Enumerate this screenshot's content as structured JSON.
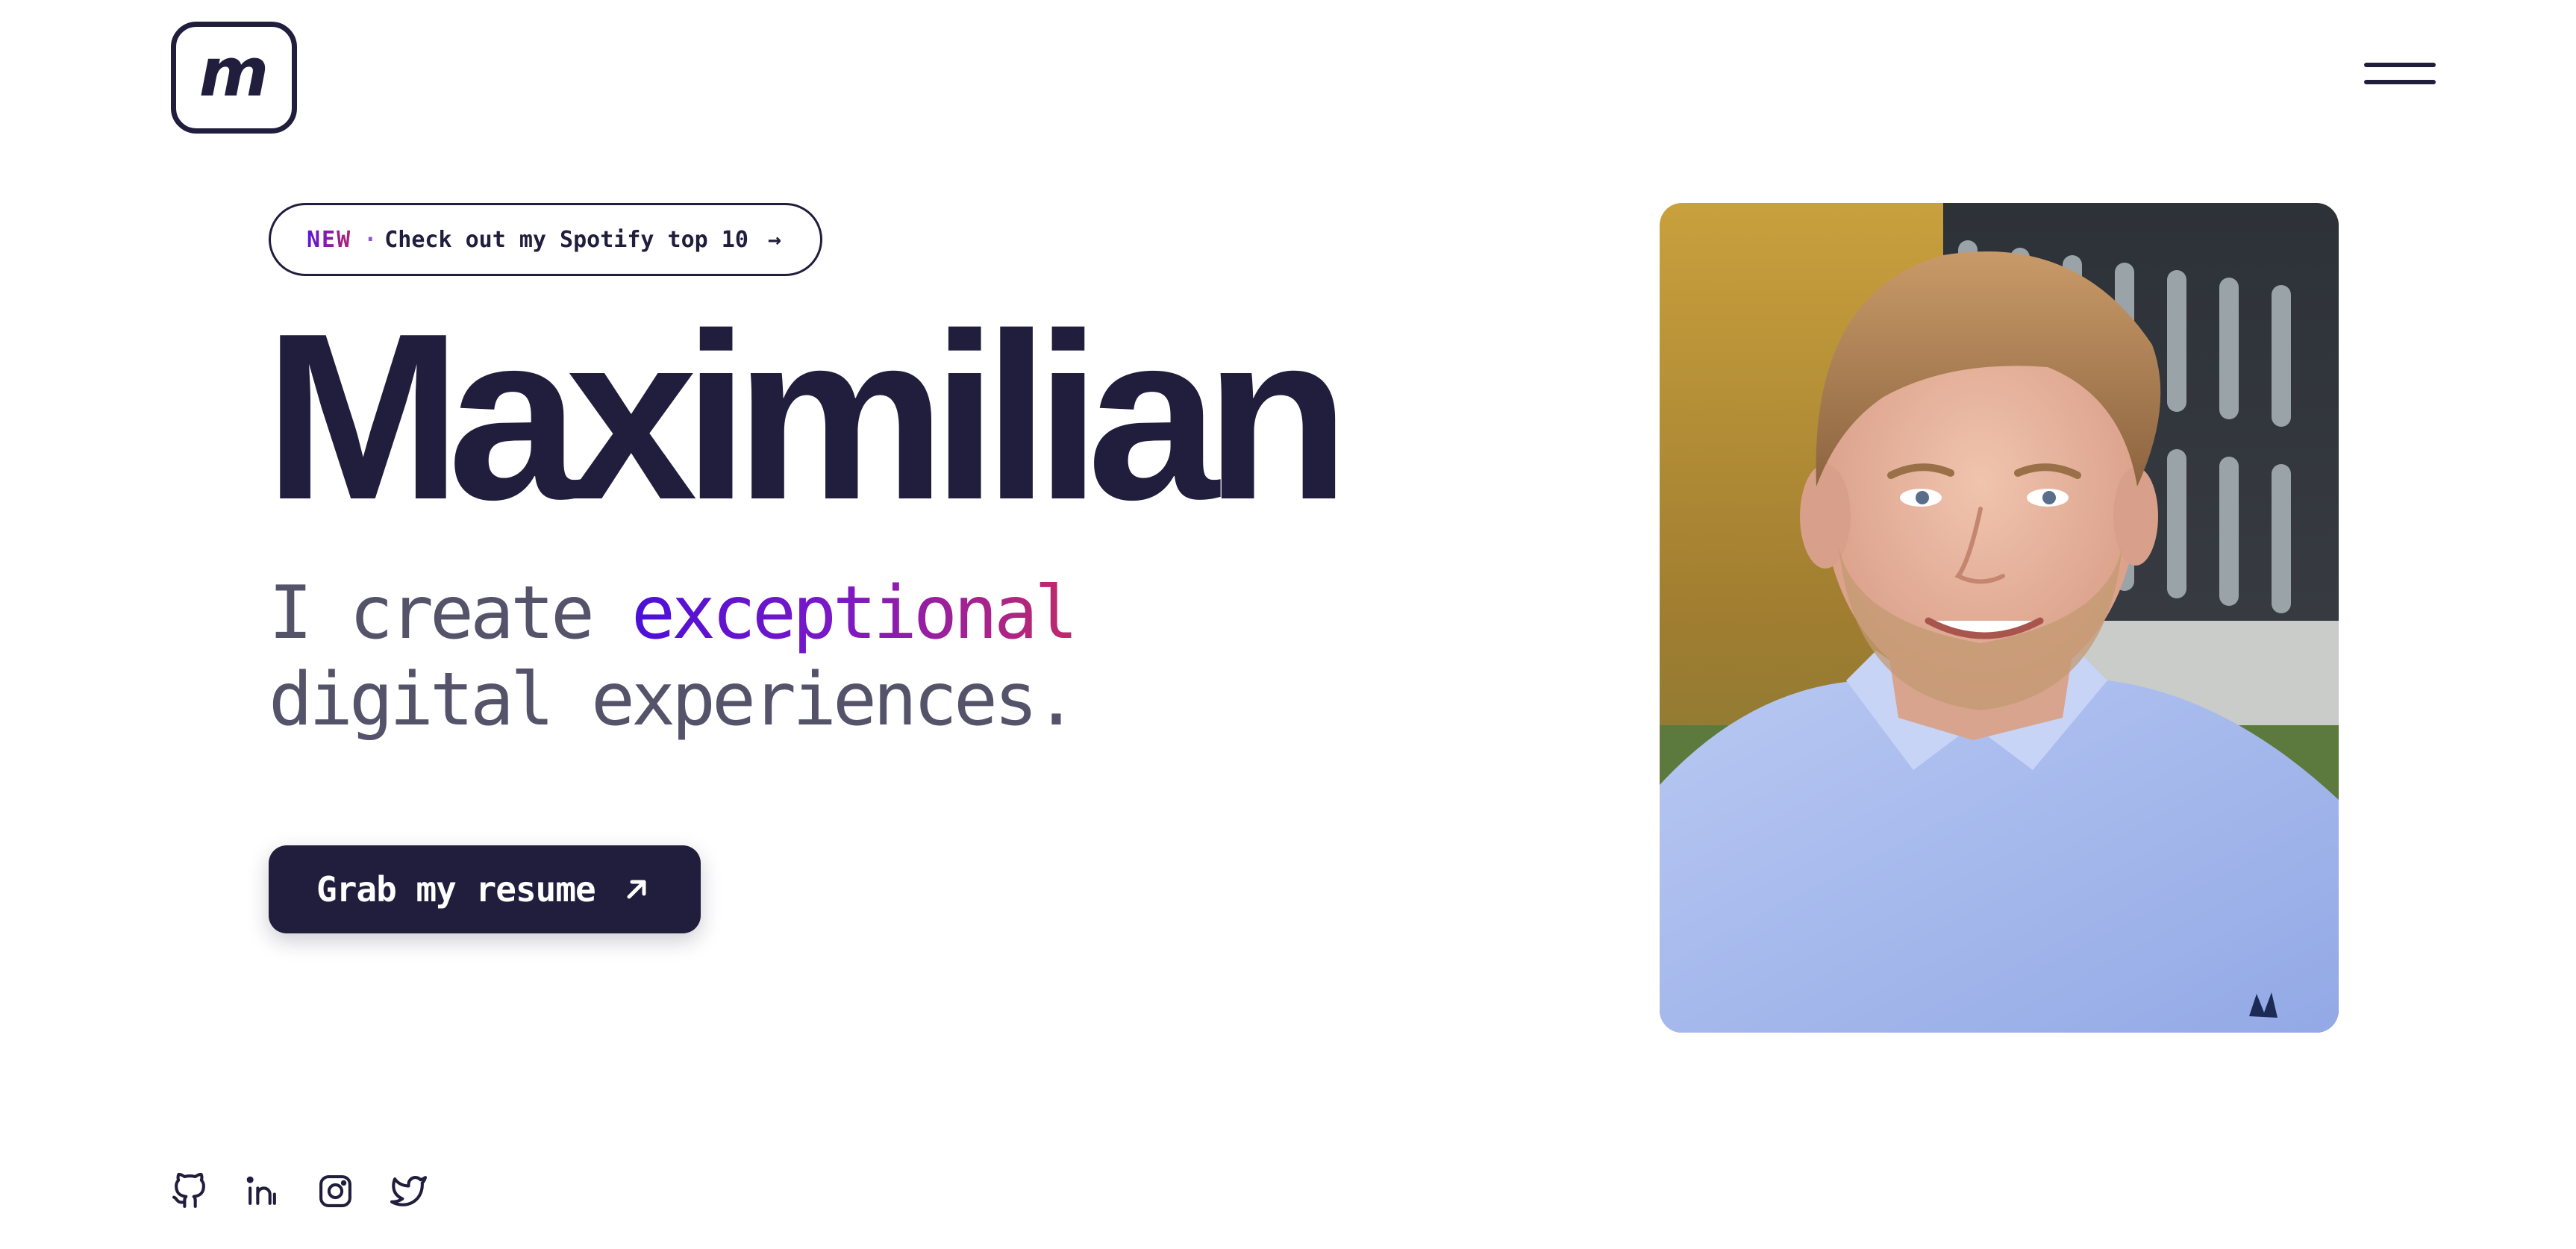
{
  "header": {
    "logo_letter": "m",
    "logo_icon": "m-monogram-logo",
    "menu_icon": "hamburger-menu-icon"
  },
  "announcement": {
    "badge": "NEW",
    "separator": "·",
    "text": "Check out my Spotify top 10",
    "arrow": "→",
    "icon": "arrow-right-icon"
  },
  "hero": {
    "name": "Maximilian",
    "tagline_prefix": "I create ",
    "tagline_highlight": "exceptional",
    "tagline_suffix": "digital experiences.",
    "cta_label": "Grab my resume",
    "cta_icon": "arrow-up-right-icon"
  },
  "social": [
    {
      "icon": "github-icon"
    },
    {
      "icon": "linkedin-icon"
    },
    {
      "icon": "instagram-icon"
    },
    {
      "icon": "twitter-icon"
    }
  ],
  "colors": {
    "primary": "#211d3d",
    "tagline_text": "#55536a",
    "gradient_start": "#4b10d8",
    "gradient_end": "#c02a6a",
    "background": "#ffffff"
  }
}
